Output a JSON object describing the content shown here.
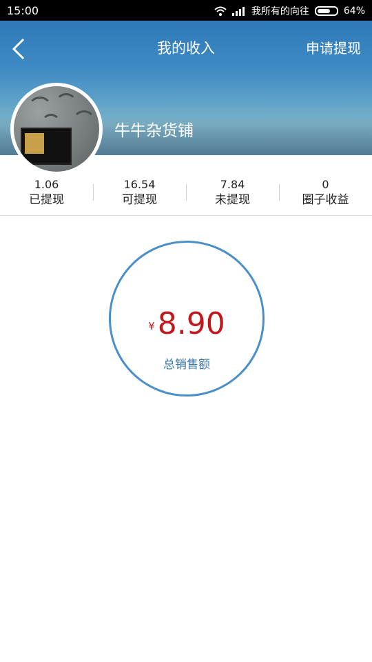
{
  "status_bar": {
    "time": "15:00",
    "carrier": "我所有的向往",
    "battery": "64%"
  },
  "header": {
    "title": "我的收入",
    "action": "申请提现"
  },
  "profile": {
    "shop_name": "牛牛杂货铺"
  },
  "stats": [
    {
      "value": "1.06",
      "label": "已提现"
    },
    {
      "value": "16.54",
      "label": "可提现"
    },
    {
      "value": "7.84",
      "label": "未提现"
    },
    {
      "value": "0",
      "label": "圈子收益"
    }
  ],
  "total": {
    "currency": "¥",
    "amount": "8.90",
    "label": "总销售额"
  },
  "colors": {
    "accent": "#4b8fc8",
    "amount": "#c0161c"
  }
}
